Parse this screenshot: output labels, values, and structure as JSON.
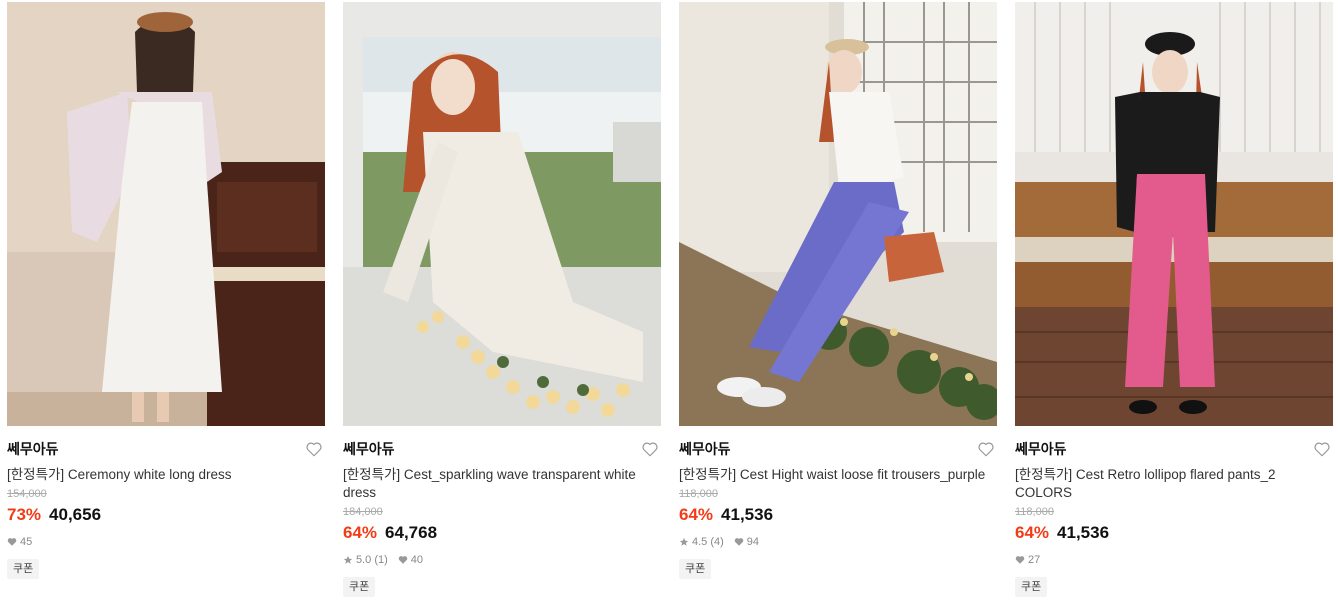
{
  "products": [
    {
      "brand": "쎄무아듀",
      "title": "[한정특가] Ceremony white long dress",
      "original_price": "154,000",
      "discount": "73%",
      "price": "40,656",
      "rating": "",
      "likes": "45",
      "badge": "쿠폰",
      "image": "woman-in-white-dress-by-piano"
    },
    {
      "brand": "쎄무아듀",
      "title": "[한정특가] Cest_sparkling wave transparent white dress",
      "original_price": "184,000",
      "discount": "64%",
      "price": "64,768",
      "rating": "5.0 (1)",
      "likes": "40",
      "badge": "쿠폰",
      "image": "woman-in-lace-dress-with-roses"
    },
    {
      "brand": "쎄무아듀",
      "title": "[한정특가] Cest Hight waist loose fit trousers_purple",
      "original_price": "118,000",
      "discount": "64%",
      "price": "41,536",
      "rating": "4.5 (4)",
      "likes": "94",
      "badge": "쿠폰",
      "image": "woman-in-purple-trousers-outdoors"
    },
    {
      "brand": "쎄무아듀",
      "title": "[한정특가] Cest Retro lollipop flared pants_2 COLORS",
      "original_price": "118,000",
      "discount": "64%",
      "price": "41,536",
      "rating": "",
      "likes": "27",
      "badge": "쿠폰",
      "image": "woman-in-pink-flared-pants"
    }
  ],
  "colors": {
    "discount": "#f23b17",
    "price": "#111111",
    "strike": "#aaaaaa"
  }
}
